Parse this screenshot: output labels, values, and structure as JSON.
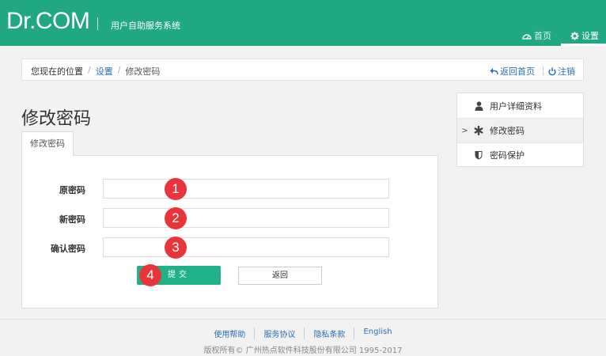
{
  "header": {
    "logo": "Dr.COM",
    "system_title": "用户自助服务系统",
    "nav_home": "首页",
    "nav_settings": "设置",
    "brand_color": "#20a882"
  },
  "breadcrumb": {
    "prefix": "您现在的位置",
    "settings": "设置",
    "current": "修改密码",
    "back_home": "返回首页",
    "logout": "注销"
  },
  "page_title": "修改密码",
  "tab_label": "修改密码",
  "form": {
    "old_password_label": "原密码",
    "new_password_label": "新密码",
    "confirm_password_label": "确认密码",
    "submit_label": "提交",
    "back_label": "返回"
  },
  "badges": [
    "1",
    "2",
    "3",
    "4"
  ],
  "side_menu": {
    "items": [
      {
        "label": "用户详细资料",
        "icon": "user-icon"
      },
      {
        "label": "修改密码",
        "icon": "asterisk-icon",
        "marker": ">"
      },
      {
        "label": "密码保护",
        "icon": "shield-icon"
      }
    ]
  },
  "footer": {
    "links": [
      "使用帮助",
      "服务协议",
      "隐私条款",
      "English"
    ],
    "copyright": "版权所有© 广州热点软件科技股份有限公司 1995-2017"
  }
}
